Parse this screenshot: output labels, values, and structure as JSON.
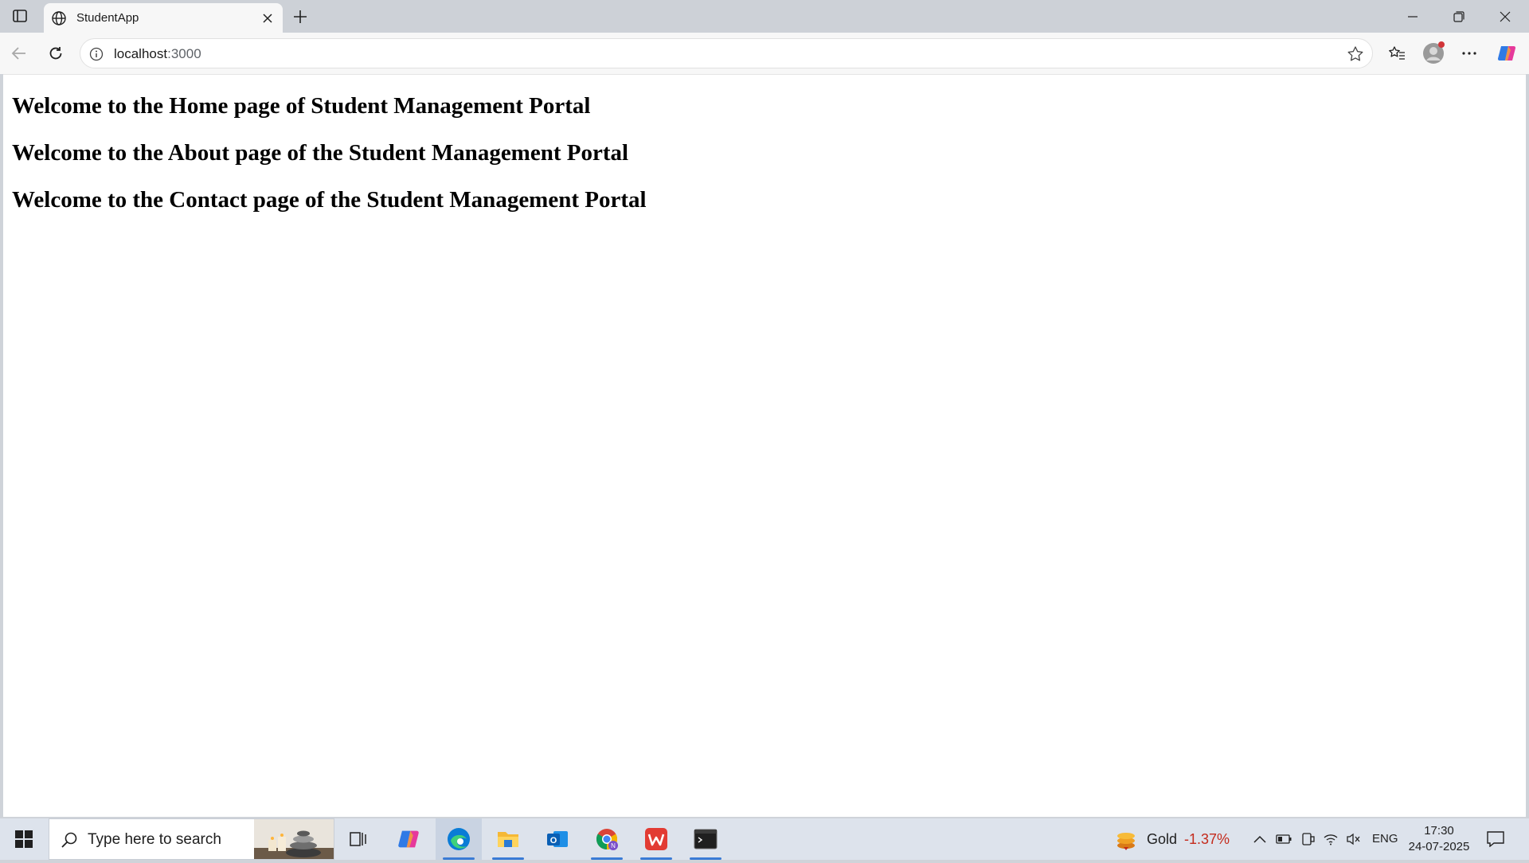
{
  "browser": {
    "tab": {
      "title": "StudentApp"
    },
    "address": {
      "host": "localhost",
      "port": ":3000"
    }
  },
  "page": {
    "headings": [
      "Welcome to the Home page of Student Management Portal",
      "Welcome to the About page of the Student Management Portal",
      "Welcome to the Contact page of the Student Management Portal"
    ]
  },
  "taskbar": {
    "search_placeholder": "Type here to search",
    "widget": {
      "name": "Gold",
      "change": "-1.37%"
    },
    "language": "ENG",
    "time": "17:30",
    "date": "24-07-2025"
  },
  "colors": {
    "accent": "#3a7bd5",
    "negative": "#c42b1c"
  }
}
